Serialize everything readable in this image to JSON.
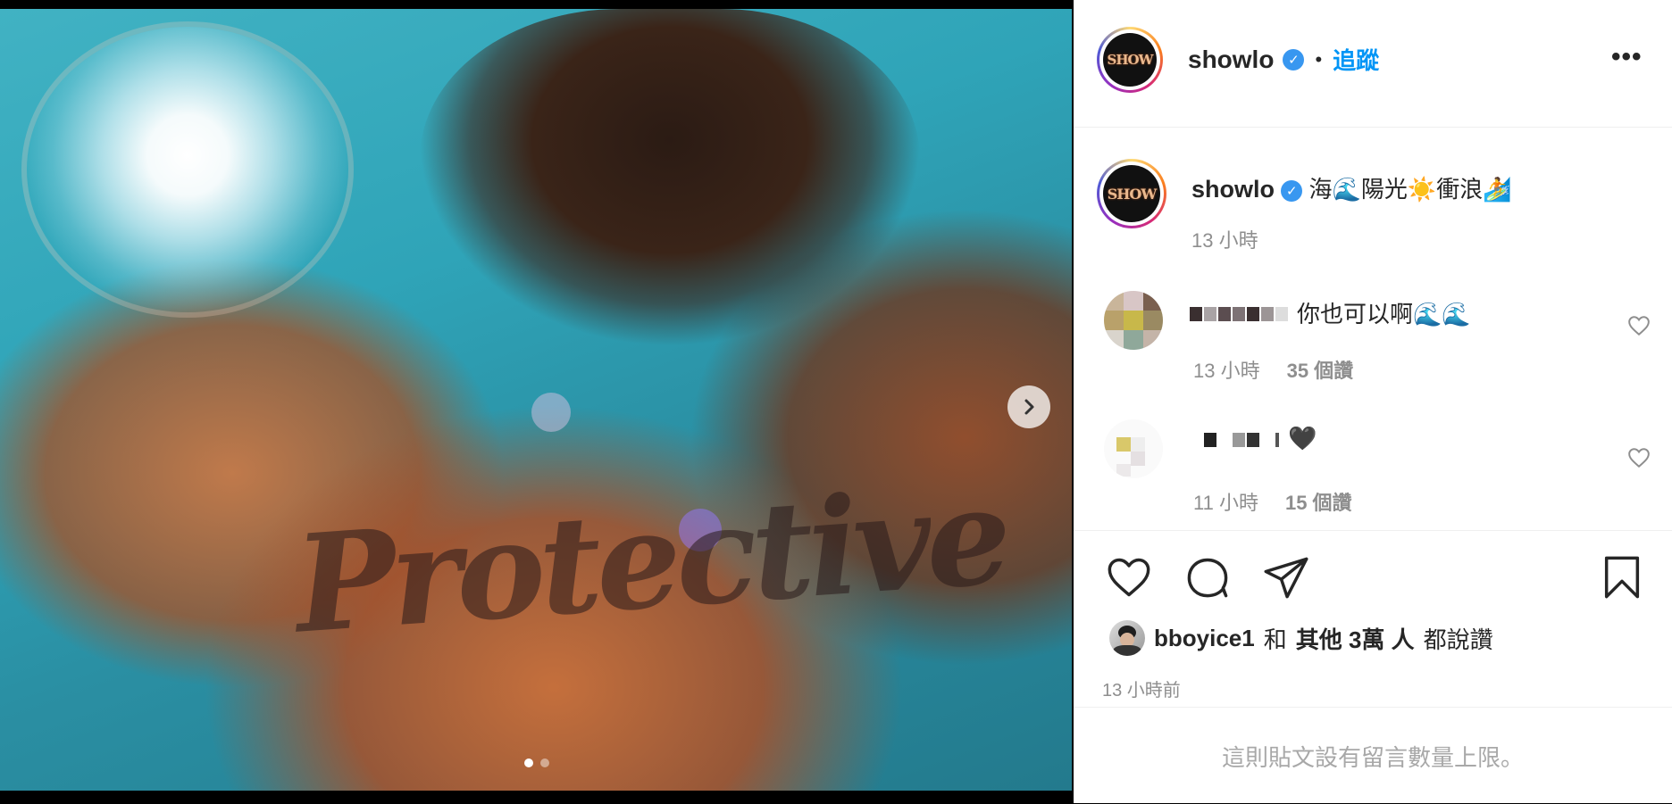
{
  "post": {
    "username": "showlo",
    "follow_label": "追蹤",
    "separator": "•",
    "more_label": "•••",
    "avatar_text": "SHOW"
  },
  "caption": {
    "username": "showlo",
    "text": "海🌊陽光☀️衝浪🏄",
    "time": "13 小時"
  },
  "comments": [
    {
      "text": "你也可以啊🌊🌊",
      "time": "13 小時",
      "likes": "35 個讚"
    },
    {
      "text": "🖤",
      "time": "11 小時",
      "likes": "15 個讚"
    }
  ],
  "likes": {
    "liker": "bboyice1",
    "and": "和",
    "others": "其他 3萬 人",
    "suffix": "都說讚"
  },
  "post_time": "13 小時前",
  "footer_note": "這則貼文設有留言數量上限。",
  "photo": {
    "tattoo_text": "Protective",
    "active_slide": 1,
    "slide_count": 2
  },
  "colors": {
    "accent": "#0095f6",
    "verified": "#3897f0",
    "muted": "#8e8e8e"
  },
  "icons": [
    "verified-badge-icon",
    "more-options-icon",
    "heart-icon",
    "comment-icon",
    "share-icon",
    "bookmark-icon",
    "next-arrow-icon"
  ]
}
